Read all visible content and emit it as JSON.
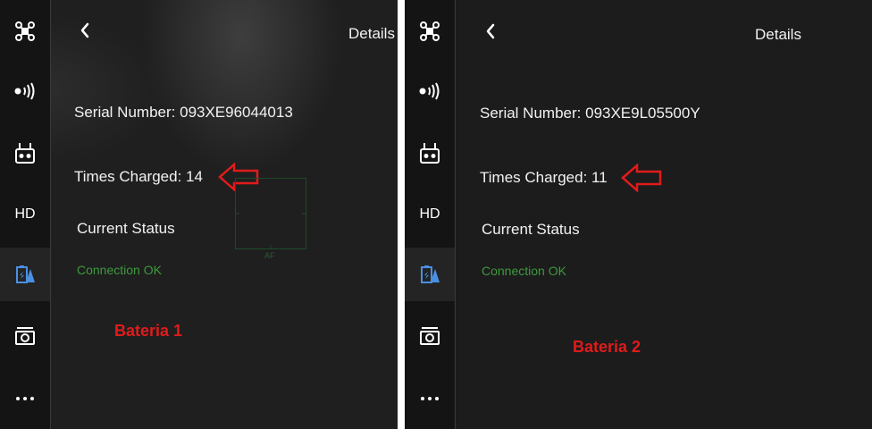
{
  "panels": [
    {
      "header": {
        "title": "Details"
      },
      "serial": {
        "label": "Serial Number:",
        "value": "093XE96044013"
      },
      "charged": {
        "label": "Times Charged:",
        "value": "14"
      },
      "status": {
        "heading": "Current Status",
        "value": "Connection OK"
      },
      "battery_label": "Bateria 1",
      "overlay": {
        "af_label": "AF"
      }
    },
    {
      "header": {
        "title": "Details"
      },
      "serial": {
        "label": "Serial Number:",
        "value": "093XE9L05500Y"
      },
      "charged": {
        "label": "Times Charged:",
        "value": "11"
      },
      "status": {
        "heading": "Current Status",
        "value": "Connection OK"
      },
      "battery_label": "Bateria 2"
    }
  ],
  "sidebar": {
    "items": [
      {
        "icon": "drone-icon"
      },
      {
        "icon": "signal-icon"
      },
      {
        "icon": "remote-controller-icon"
      },
      {
        "icon": "hd-icon",
        "label": "HD"
      },
      {
        "icon": "battery-icon",
        "active": true
      },
      {
        "icon": "camera-icon"
      },
      {
        "icon": "more-icon"
      }
    ]
  },
  "colors": {
    "background": "#1f1f1f",
    "sidebar": "#141414",
    "status_ok": "#3e9a3e",
    "annotation_red": "#e01b1b",
    "active_icon": "#4a90e2"
  }
}
